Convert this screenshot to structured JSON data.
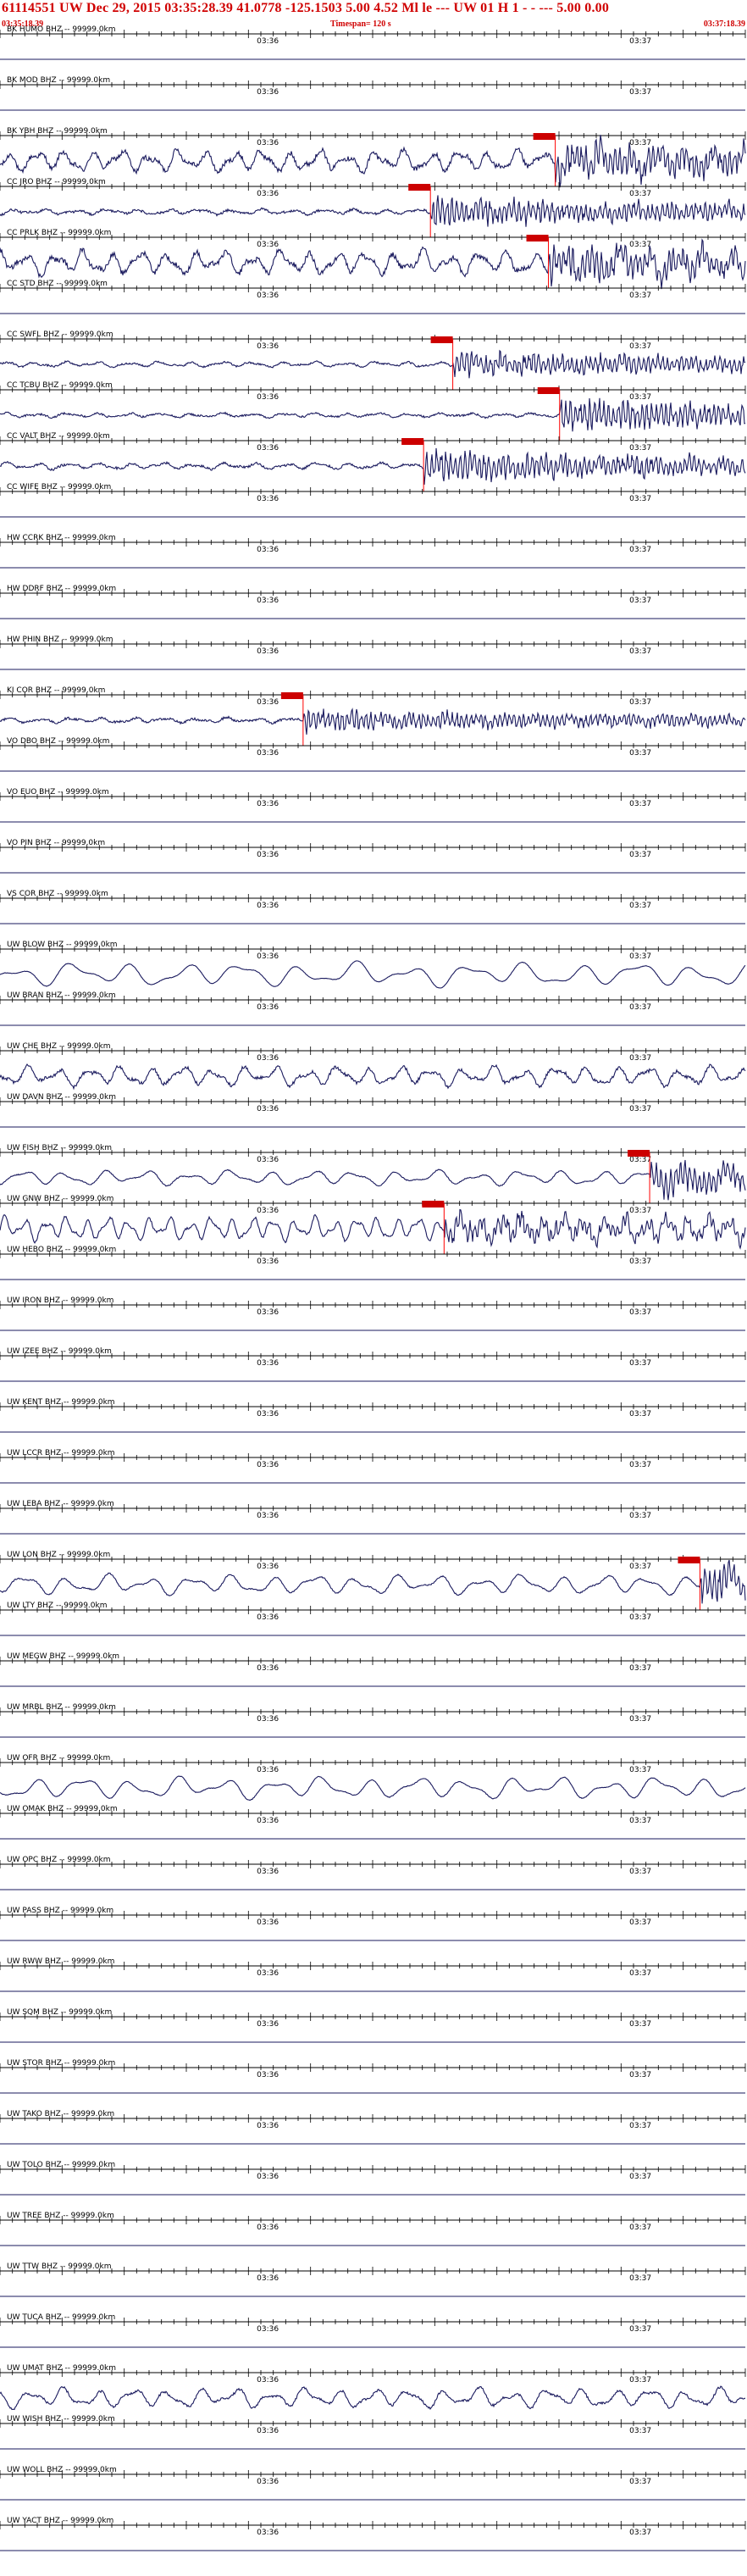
{
  "header": {
    "title": "61114551 UW Dec 29, 2015 03:35:28.39    41.0778 -125.1503   5.00 4.52 Ml le     ---     UW 01 H    1  - - ---   5.00 0.00",
    "start_time": "03:35:18.39",
    "timespan": "Timespan= 120 s",
    "end_time": "03:37:18.39"
  },
  "colors": {
    "header_text": "#d00000",
    "trace": "#1a1a5e",
    "axis": "#000000",
    "pick_flag": "#cc0000",
    "pick_line": "#ff0000"
  },
  "chart_data": {
    "type": "line",
    "title": "61114551 UW Dec 29, 2015 03:35:28.39    41.0778 -125.1503   5.00 4.52 Ml le     ---     UW 01 H    1  - - ---   5.00 0.00",
    "x_range": [
      "03:35:18.39",
      "03:37:18.39"
    ],
    "x_unit": "s",
    "timespan_s": 120,
    "tick_labels": [
      "03:36",
      "03:37"
    ],
    "tick_positions_s": [
      41.61,
      101.61
    ],
    "grid": false,
    "channels": [
      {
        "label": "BK HUMO BHZ -- 99999.0km",
        "signal": false
      },
      {
        "label": "BK MOD BHZ -- 99999.0km",
        "signal": false
      },
      {
        "label": "BK YBH BHZ -- 99999.0km",
        "signal": true,
        "pick_s": 89.4,
        "amp": 0.5,
        "burst": 0.95,
        "freq": 0.22,
        "noise": 0.22
      },
      {
        "label": "CC JRO BHZ -- 99999.0km",
        "signal": true,
        "pick_s": 69.3,
        "amp": 0.12,
        "burst": 0.8,
        "freq": 0.2,
        "noise": 0.1
      },
      {
        "label": "CC PRLK BHZ -- 99999.0km",
        "signal": true,
        "pick_s": 88.3,
        "amp": 0.55,
        "burst": 0.95,
        "freq": 0.22,
        "noise": 0.22
      },
      {
        "label": "CC STD BHZ -- 99999.0km",
        "signal": false
      },
      {
        "label": "CC SWFL BHZ -- 99999.0km",
        "signal": true,
        "pick_s": 72.9,
        "amp": 0.12,
        "burst": 0.7,
        "freq": 0.2,
        "noise": 0.08
      },
      {
        "label": "CC TCBU BHZ -- 99999.0km",
        "signal": true,
        "pick_s": 90.1,
        "amp": 0.1,
        "burst": 0.85,
        "freq": 0.2,
        "noise": 0.08
      },
      {
        "label": "CC VALT BHZ -- 99999.0km",
        "signal": true,
        "pick_s": 68.2,
        "amp": 0.15,
        "burst": 0.85,
        "freq": 0.2,
        "noise": 0.1
      },
      {
        "label": "CC WIFE BHZ -- 99999.0km",
        "signal": false
      },
      {
        "label": "HW CCRK BHZ -- 99999.0km",
        "signal": false
      },
      {
        "label": "HW DDRF BHZ -- 99999.0km",
        "signal": false
      },
      {
        "label": "HW PHIN BHZ -- 99999.0km",
        "signal": false
      },
      {
        "label": "KI COR BHZ -- 99999.0km",
        "signal": true,
        "pick_s": 48.8,
        "amp": 0.12,
        "burst": 0.6,
        "freq": 0.2,
        "noise": 0.1
      },
      {
        "label": "VO DBO BHZ -- 99999.0km",
        "signal": false
      },
      {
        "label": "VO EUO BHZ -- 99999.0km",
        "signal": false
      },
      {
        "label": "VO PIN BHZ -- 99999.0km",
        "signal": false
      },
      {
        "label": "VS COR BHZ -- 99999.0km",
        "signal": false
      },
      {
        "label": "UW BLOW BHZ -- 99999.0km",
        "signal": true,
        "pick_s": null,
        "amp": 0.55,
        "burst": 0,
        "freq": 0.11,
        "noise": 0.02
      },
      {
        "label": "UW BRAN BHZ -- 99999.0km",
        "signal": false
      },
      {
        "label": "UW CHE BHZ -- 99999.0km",
        "signal": true,
        "pick_s": null,
        "amp": 0.45,
        "burst": 0,
        "freq": 0.2,
        "noise": 0.14
      },
      {
        "label": "UW DAVN BHZ -- 99999.0km",
        "signal": false
      },
      {
        "label": "UW FISH BHZ -- 99999.0km",
        "signal": true,
        "pick_s": 104.6,
        "amp": 0.35,
        "burst": 0.8,
        "freq": 0.15,
        "noise": 0.04
      },
      {
        "label": "UW GNW BHZ -- 99999.0km",
        "signal": true,
        "pick_s": 71.5,
        "amp": 0.55,
        "burst": 0.6,
        "freq": 0.3,
        "noise": 0.1
      },
      {
        "label": "UW HEBO BHZ -- 99999.0km",
        "signal": false
      },
      {
        "label": "UW IRON BHZ -- 99999.0km",
        "signal": false
      },
      {
        "label": "UW IZEE BHZ -- 99999.0km",
        "signal": false
      },
      {
        "label": "UW KENT BHZ -- 99999.0km",
        "signal": false
      },
      {
        "label": "UW LCCR BHZ -- 99999.0km",
        "signal": false
      },
      {
        "label": "UW LEBA BHZ -- 99999.0km",
        "signal": false
      },
      {
        "label": "UW LON BHZ -- 99999.0km",
        "signal": true,
        "pick_s": 112.7,
        "amp": 0.45,
        "burst": 0.9,
        "freq": 0.15,
        "noise": 0.05
      },
      {
        "label": "UW LTY BHZ -- 99999.0km",
        "signal": false
      },
      {
        "label": "UW MEGW BHZ -- 99999.0km",
        "signal": false
      },
      {
        "label": "UW MRBL BHZ -- 99999.0km",
        "signal": false
      },
      {
        "label": "UW OFR BHZ -- 99999.0km",
        "signal": true,
        "pick_s": null,
        "amp": 0.5,
        "burst": 0,
        "freq": 0.13,
        "noise": 0.03
      },
      {
        "label": "UW OMAK BHZ -- 99999.0km",
        "signal": false
      },
      {
        "label": "UW OPC BHZ -- 99999.0km",
        "signal": false
      },
      {
        "label": "UW PASS BHZ -- 99999.0km",
        "signal": false
      },
      {
        "label": "UW RWW BHZ -- 99999.0km",
        "signal": false
      },
      {
        "label": "UW SQM BHZ -- 99999.0km",
        "signal": false
      },
      {
        "label": "UW STOR BHZ -- 99999.0km",
        "signal": false
      },
      {
        "label": "UW TAKO BHZ -- 99999.0km",
        "signal": false
      },
      {
        "label": "UW TOLO BHZ -- 99999.0km",
        "signal": false
      },
      {
        "label": "UW TREE BHZ -- 99999.0km",
        "signal": false
      },
      {
        "label": "UW TTW BHZ -- 99999.0km",
        "signal": false
      },
      {
        "label": "UW TUCA BHZ -- 99999.0km",
        "signal": false
      },
      {
        "label": "UW UMAT BHZ -- 99999.0km",
        "signal": true,
        "pick_s": null,
        "amp": 0.45,
        "burst": 0,
        "freq": 0.18,
        "noise": 0.1
      },
      {
        "label": "UW WISH BHZ -- 99999.0km",
        "signal": false
      },
      {
        "label": "UW WOLL BHZ -- 99999.0km",
        "signal": false
      },
      {
        "label": "UW YACT BHZ -- 99999.0km",
        "signal": false
      }
    ]
  }
}
